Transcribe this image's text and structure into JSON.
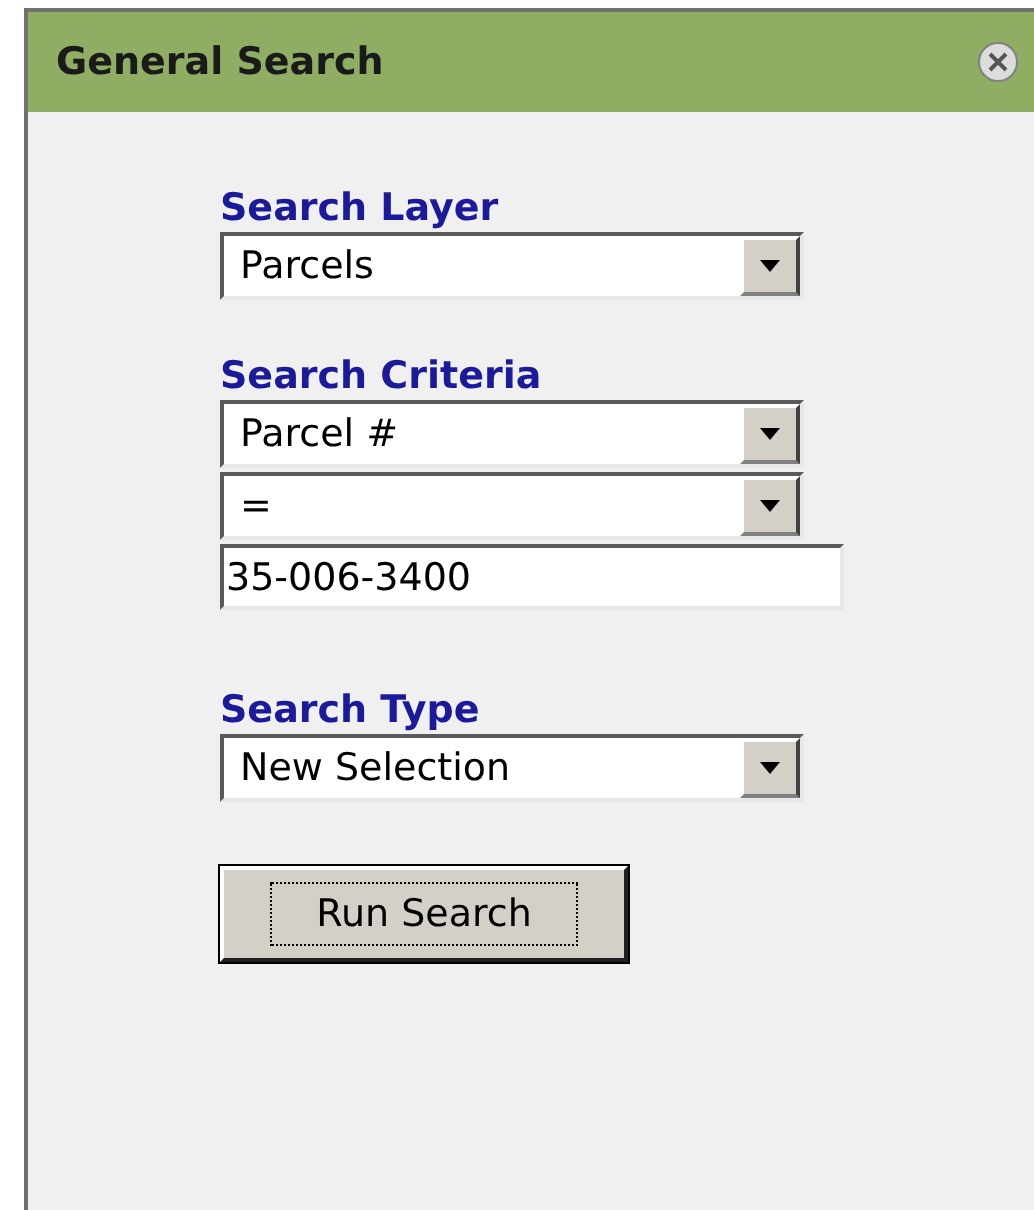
{
  "panel": {
    "title": "General Search"
  },
  "sections": [
    {
      "label": "Search Layer",
      "fields": [
        {
          "kind": "select",
          "value": "Parcels"
        }
      ]
    },
    {
      "label": "Search Criteria",
      "fields": [
        {
          "kind": "select",
          "value": "Parcel #"
        },
        {
          "kind": "select",
          "value": "="
        },
        {
          "kind": "text",
          "value": "35-006-3400"
        }
      ]
    },
    {
      "label": "Search Type",
      "fields": [
        {
          "kind": "select",
          "value": "New Selection"
        }
      ]
    }
  ],
  "button": {
    "label": "Run Search"
  }
}
